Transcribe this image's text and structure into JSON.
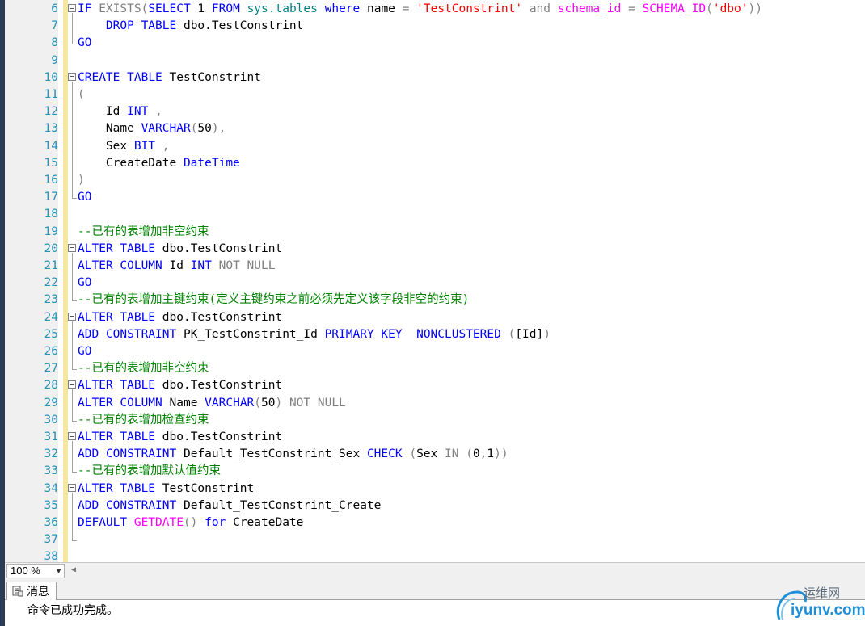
{
  "editor": {
    "lines": [
      {
        "n": "6",
        "tokens": [
          {
            "c": "k",
            "t": "IF"
          },
          {
            "c": "",
            "t": " "
          },
          {
            "c": "g",
            "t": "EXISTS("
          },
          {
            "c": "k",
            "t": "SELECT"
          },
          {
            "c": "",
            "t": " 1 "
          },
          {
            "c": "k",
            "t": "FROM"
          },
          {
            "c": "",
            "t": " "
          },
          {
            "c": "t",
            "t": "sys.tables"
          },
          {
            "c": "",
            "t": " "
          },
          {
            "c": "k",
            "t": "where"
          },
          {
            "c": "",
            "t": " name "
          },
          {
            "c": "g",
            "t": "="
          },
          {
            "c": "",
            "t": " "
          },
          {
            "c": "r",
            "t": "'TestConstrint'"
          },
          {
            "c": "",
            "t": " "
          },
          {
            "c": "g",
            "t": "and"
          },
          {
            "c": "",
            "t": " "
          },
          {
            "c": "m",
            "t": "schema_id"
          },
          {
            "c": "",
            "t": " "
          },
          {
            "c": "g",
            "t": "="
          },
          {
            "c": "",
            "t": " "
          },
          {
            "c": "m",
            "t": "SCHEMA_ID"
          },
          {
            "c": "g",
            "t": "("
          },
          {
            "c": "r",
            "t": "'dbo'"
          },
          {
            "c": "g",
            "t": "))"
          }
        ]
      },
      {
        "n": "7",
        "tokens": [
          {
            "c": "",
            "t": "    "
          },
          {
            "c": "k",
            "t": "DROP"
          },
          {
            "c": "",
            "t": " "
          },
          {
            "c": "k",
            "t": "TABLE"
          },
          {
            "c": "",
            "t": " dbo.TestConstrint"
          }
        ]
      },
      {
        "n": "8",
        "tokens": [
          {
            "c": "k",
            "t": "GO"
          }
        ]
      },
      {
        "n": "9",
        "tokens": []
      },
      {
        "n": "10",
        "tokens": [
          {
            "c": "k",
            "t": "CREATE"
          },
          {
            "c": "",
            "t": " "
          },
          {
            "c": "k",
            "t": "TABLE"
          },
          {
            "c": "",
            "t": " TestConstrint"
          }
        ]
      },
      {
        "n": "11",
        "tokens": [
          {
            "c": "g",
            "t": "("
          }
        ]
      },
      {
        "n": "12",
        "tokens": [
          {
            "c": "",
            "t": "    Id "
          },
          {
            "c": "k",
            "t": "INT"
          },
          {
            "c": "",
            "t": " "
          },
          {
            "c": "g",
            "t": ","
          }
        ]
      },
      {
        "n": "13",
        "tokens": [
          {
            "c": "",
            "t": "    Name "
          },
          {
            "c": "k",
            "t": "VARCHAR"
          },
          {
            "c": "g",
            "t": "("
          },
          {
            "c": "",
            "t": "50"
          },
          {
            "c": "g",
            "t": "),"
          }
        ]
      },
      {
        "n": "14",
        "tokens": [
          {
            "c": "",
            "t": "    Sex "
          },
          {
            "c": "k",
            "t": "BIT"
          },
          {
            "c": "",
            "t": " "
          },
          {
            "c": "g",
            "t": ","
          }
        ]
      },
      {
        "n": "15",
        "tokens": [
          {
            "c": "",
            "t": "    CreateDate "
          },
          {
            "c": "k",
            "t": "DateTime"
          }
        ]
      },
      {
        "n": "16",
        "tokens": [
          {
            "c": "g",
            "t": ")"
          }
        ]
      },
      {
        "n": "17",
        "tokens": [
          {
            "c": "k",
            "t": "GO"
          }
        ]
      },
      {
        "n": "18",
        "tokens": []
      },
      {
        "n": "19",
        "tokens": [
          {
            "c": "c",
            "t": "--已有的表增加非空约束"
          }
        ]
      },
      {
        "n": "20",
        "tokens": [
          {
            "c": "k",
            "t": "ALTER"
          },
          {
            "c": "",
            "t": " "
          },
          {
            "c": "k",
            "t": "TABLE"
          },
          {
            "c": "",
            "t": " dbo.TestConstrint"
          }
        ]
      },
      {
        "n": "21",
        "tokens": [
          {
            "c": "k",
            "t": "ALTER"
          },
          {
            "c": "",
            "t": " "
          },
          {
            "c": "k",
            "t": "COLUMN"
          },
          {
            "c": "",
            "t": " Id "
          },
          {
            "c": "k",
            "t": "INT"
          },
          {
            "c": "",
            "t": " "
          },
          {
            "c": "g",
            "t": "NOT NULL"
          }
        ]
      },
      {
        "n": "22",
        "tokens": [
          {
            "c": "k",
            "t": "GO"
          }
        ]
      },
      {
        "n": "23",
        "tokens": [
          {
            "c": "c",
            "t": "--已有的表增加主键约束(定义主键约束之前必须先定义该字段非空的约束)"
          }
        ]
      },
      {
        "n": "24",
        "tokens": [
          {
            "c": "k",
            "t": "ALTER"
          },
          {
            "c": "",
            "t": " "
          },
          {
            "c": "k",
            "t": "TABLE"
          },
          {
            "c": "",
            "t": " dbo.TestConstrint"
          }
        ]
      },
      {
        "n": "25",
        "tokens": [
          {
            "c": "k",
            "t": "ADD"
          },
          {
            "c": "",
            "t": " "
          },
          {
            "c": "k",
            "t": "CONSTRAINT"
          },
          {
            "c": "",
            "t": " PK_TestConstrint_Id "
          },
          {
            "c": "k",
            "t": "PRIMARY"
          },
          {
            "c": "",
            "t": " "
          },
          {
            "c": "k",
            "t": "KEY"
          },
          {
            "c": "",
            "t": "  "
          },
          {
            "c": "k",
            "t": "NONCLUSTERED"
          },
          {
            "c": "",
            "t": " "
          },
          {
            "c": "g",
            "t": "("
          },
          {
            "c": "",
            "t": "[Id]"
          },
          {
            "c": "g",
            "t": ")"
          }
        ]
      },
      {
        "n": "26",
        "tokens": [
          {
            "c": "k",
            "t": "GO"
          }
        ]
      },
      {
        "n": "27",
        "tokens": [
          {
            "c": "c",
            "t": "--已有的表增加非空约束"
          }
        ]
      },
      {
        "n": "28",
        "tokens": [
          {
            "c": "k",
            "t": "ALTER"
          },
          {
            "c": "",
            "t": " "
          },
          {
            "c": "k",
            "t": "TABLE"
          },
          {
            "c": "",
            "t": " dbo.TestConstrint"
          }
        ]
      },
      {
        "n": "29",
        "tokens": [
          {
            "c": "k",
            "t": "ALTER"
          },
          {
            "c": "",
            "t": " "
          },
          {
            "c": "k",
            "t": "COLUMN"
          },
          {
            "c": "",
            "t": " Name "
          },
          {
            "c": "k",
            "t": "VARCHAR"
          },
          {
            "c": "g",
            "t": "("
          },
          {
            "c": "",
            "t": "50"
          },
          {
            "c": "g",
            "t": ")"
          },
          {
            "c": "",
            "t": " "
          },
          {
            "c": "g",
            "t": "NOT NULL"
          }
        ]
      },
      {
        "n": "30",
        "tokens": [
          {
            "c": "c",
            "t": "--已有的表增加检查约束"
          }
        ]
      },
      {
        "n": "31",
        "tokens": [
          {
            "c": "k",
            "t": "ALTER"
          },
          {
            "c": "",
            "t": " "
          },
          {
            "c": "k",
            "t": "TABLE"
          },
          {
            "c": "",
            "t": " dbo.TestConstrint"
          }
        ]
      },
      {
        "n": "32",
        "tokens": [
          {
            "c": "k",
            "t": "ADD"
          },
          {
            "c": "",
            "t": " "
          },
          {
            "c": "k",
            "t": "CONSTRAINT"
          },
          {
            "c": "",
            "t": " Default_TestConstrint_Sex "
          },
          {
            "c": "k",
            "t": "CHECK"
          },
          {
            "c": "",
            "t": " "
          },
          {
            "c": "g",
            "t": "("
          },
          {
            "c": "",
            "t": "Sex "
          },
          {
            "c": "g",
            "t": "IN"
          },
          {
            "c": "",
            "t": " "
          },
          {
            "c": "g",
            "t": "("
          },
          {
            "c": "",
            "t": "0"
          },
          {
            "c": "g",
            "t": ","
          },
          {
            "c": "",
            "t": "1"
          },
          {
            "c": "g",
            "t": "))"
          }
        ]
      },
      {
        "n": "33",
        "tokens": [
          {
            "c": "c",
            "t": "--已有的表增加默认值约束"
          }
        ]
      },
      {
        "n": "34",
        "tokens": [
          {
            "c": "k",
            "t": "ALTER"
          },
          {
            "c": "",
            "t": " "
          },
          {
            "c": "k",
            "t": "TABLE"
          },
          {
            "c": "",
            "t": " TestConstrint"
          }
        ]
      },
      {
        "n": "35",
        "tokens": [
          {
            "c": "k",
            "t": "ADD"
          },
          {
            "c": "",
            "t": " "
          },
          {
            "c": "k",
            "t": "CONSTRAINT"
          },
          {
            "c": "",
            "t": " Default_TestConstrint_Create"
          }
        ]
      },
      {
        "n": "36",
        "tokens": [
          {
            "c": "k",
            "t": "DEFAULT"
          },
          {
            "c": "",
            "t": " "
          },
          {
            "c": "m",
            "t": "GETDATE"
          },
          {
            "c": "g",
            "t": "()"
          },
          {
            "c": "",
            "t": " "
          },
          {
            "c": "k",
            "t": "for"
          },
          {
            "c": "",
            "t": " CreateDate"
          }
        ]
      },
      {
        "n": "37",
        "tokens": []
      },
      {
        "n": "38",
        "tokens": []
      }
    ]
  },
  "zoom": {
    "value": "100 %"
  },
  "messages": {
    "tab_label": "消息",
    "text": "命令已成功完成。"
  },
  "watermark": {
    "top": "运维网",
    "bottom": "iyunv.com"
  }
}
